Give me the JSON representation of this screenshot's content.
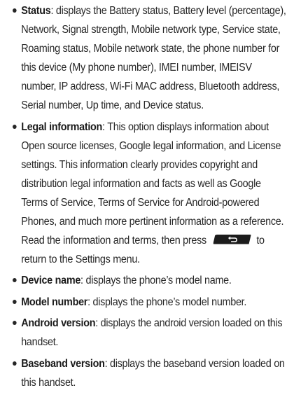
{
  "items": [
    {
      "term": "Status",
      "text": ": displays the Battery status, Battery level (percentage), Network, Signal strength, Mobile network type, Service state, Roaming status, Mobile network state, the phone number for this device (My phone number), IMEI number, IMEISV number, IP address, Wi-Fi MAC address, Bluetooth address, Serial number, Up time, and Device status."
    },
    {
      "term": "Legal information",
      "text": ": This option displays information about Open source licenses, Google legal information, and License settings. This information clearly provides copyright and distribution legal information and facts as well as Google Terms of Service, Terms of Service for Android-powered Phones, and much more pertinent information as a reference. Read the information and terms, then press",
      "key_icon": "back-key-icon",
      "text_after": "to return to the Settings menu."
    },
    {
      "term": "Device name",
      "text": ": displays the phone’s model name."
    },
    {
      "term": "Model number",
      "text": ": displays the phone’s model number."
    },
    {
      "term": "Android version",
      "text": ": displays the android version loaded on this handset."
    },
    {
      "term": "Baseband version",
      "text": ": displays the baseband version loaded on this handset."
    }
  ]
}
